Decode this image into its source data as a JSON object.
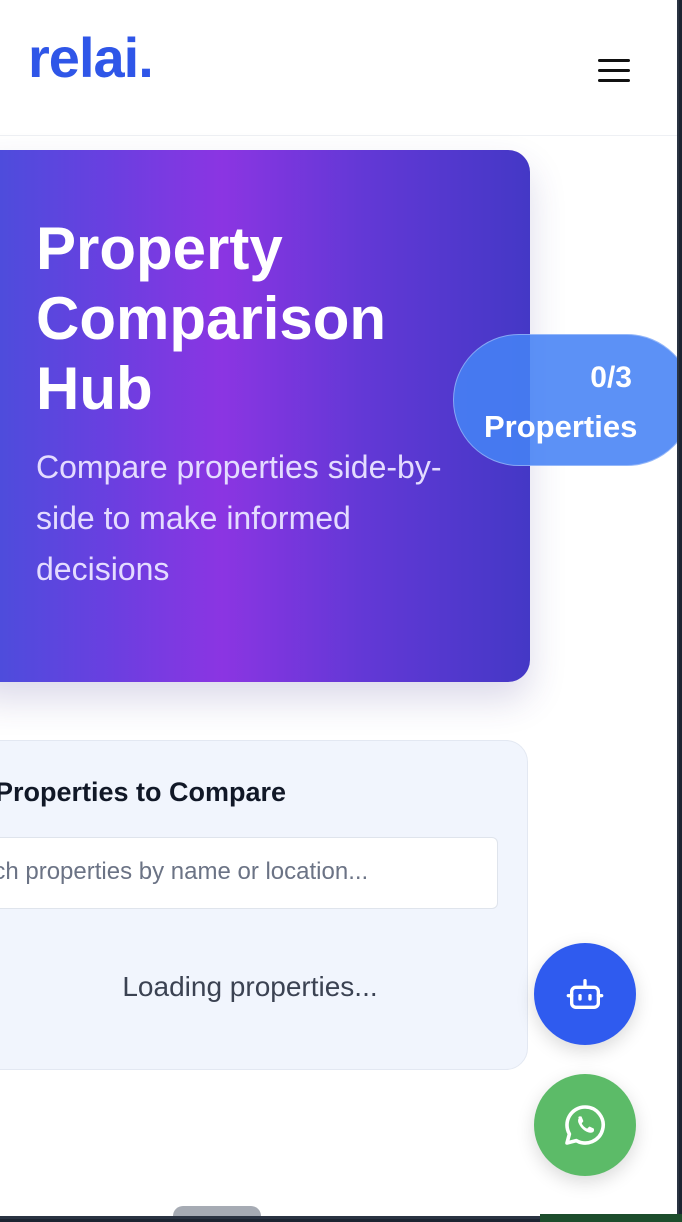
{
  "header": {
    "logo_text": "relai.",
    "menu_icon": "hamburger-menu-icon"
  },
  "hero": {
    "title": "Property Comparison Hub",
    "subtitle": "Compare properties side-by-side to make informed decisions"
  },
  "counter": {
    "count": "0/3",
    "label": "Properties"
  },
  "compare_panel": {
    "title": "Properties to Compare",
    "search_placeholder": "arch properties by name or location...",
    "loading_text": "Loading properties..."
  },
  "fabs": {
    "chatbot_icon": "robot-icon",
    "whatsapp_icon": "whatsapp-icon"
  },
  "colors": {
    "brand": "#2f56e8",
    "hero_gradient_start": "#4650db",
    "hero_gradient_mid": "#8b35e2",
    "hero_gradient_end": "#4438c6",
    "counter_bg": "#4682f5",
    "chatbot_fab": "#2f5bef",
    "whatsapp_fab": "#5cbb68"
  }
}
